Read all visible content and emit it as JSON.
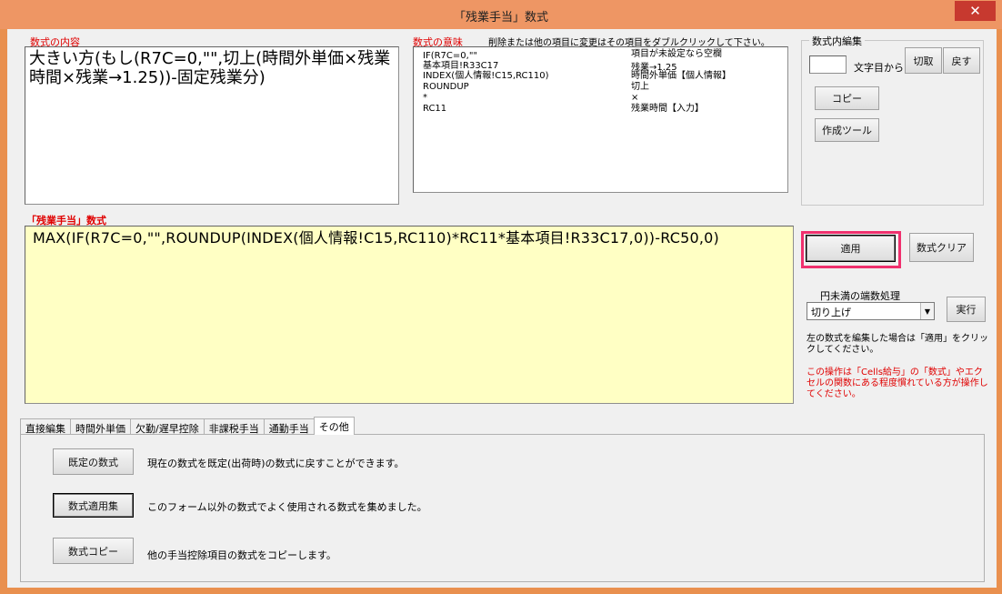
{
  "window": {
    "title": "「残業手当」数式",
    "close_glyph": "✕"
  },
  "content": {
    "label": "数式の内容",
    "text": "大きい方(もし(R7C=0,\"\",切上(時間外単価×残業時間×残業→1.25))-固定残業分)"
  },
  "meaning": {
    "label": "数式の意味",
    "hint": "削除または他の項目に変更はその項目をダブルクリックして下さい。",
    "rows": [
      {
        "term": "IF(R7C=0,\"\"",
        "desc": "項目が未設定なら空欄"
      },
      {
        "term": "基本項目!R33C17",
        "desc": "残業→1.25"
      },
      {
        "term": "INDEX(個人情報!C15,RC110)",
        "desc": "時間外単価【個人情報】"
      },
      {
        "term": "ROUNDUP",
        "desc": "切上"
      },
      {
        "term": "*",
        "desc": "×"
      },
      {
        "term": "RC11",
        "desc": "残業時間【入力】"
      }
    ]
  },
  "edit_group": {
    "title": "数式内編集",
    "char_input_value": "",
    "char_label": "文字目から",
    "cut_label": "切取",
    "back_label": "戻す",
    "copy_label": "コピー",
    "tool_label": "作成ツール"
  },
  "formula": {
    "label": "「残業手当」数式",
    "text": "MAX(IF(R7C=0,\"\",ROUNDUP(INDEX(個人情報!C15,RC110)*RC11*基本項目!R33C17,0))-RC50,0)"
  },
  "actions": {
    "apply_label": "適用",
    "clear_label": "数式クリア",
    "rounding_label": "円未満の端数処理",
    "rounding_value": "切り上げ",
    "execute_label": "実行",
    "note1": "左の数式を編集した場合は「適用」をクリックしてください。",
    "note2": "この操作は「Cells給与」の「数式」やエクセルの関数にある程度慣れている方が操作してください。",
    "note2_color": "#e00000",
    "highlight_color": "#f0306e"
  },
  "tabs": [
    {
      "label": "直接編集",
      "active": false
    },
    {
      "label": "時間外単価",
      "active": false
    },
    {
      "label": "欠勤/遅早控除",
      "active": false
    },
    {
      "label": "非課税手当",
      "active": false
    },
    {
      "label": "通勤手当",
      "active": false
    },
    {
      "label": "その他",
      "active": true
    }
  ],
  "other_tab": {
    "rows": [
      {
        "button": "既定の数式",
        "text": "現在の数式を既定(出荷時)の数式に戻すことができます。"
      },
      {
        "button": "数式適用集",
        "text": "このフォーム以外の数式でよく使用される数式を集めました。"
      },
      {
        "button": "数式コピー",
        "text": "他の手当控除項目の数式をコピーします。"
      }
    ]
  }
}
